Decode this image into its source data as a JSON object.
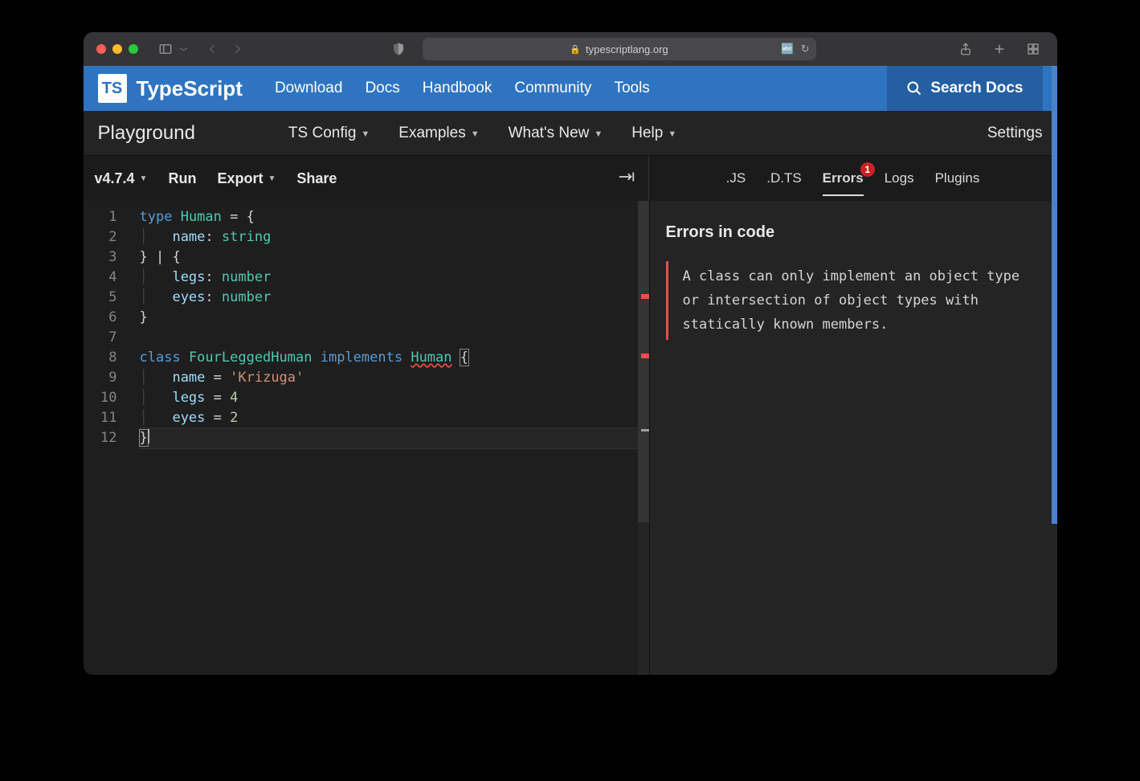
{
  "browser": {
    "url": "typescriptlang.org"
  },
  "topnav": {
    "brand": "TypeScript",
    "logo_abbr": "TS",
    "links": [
      "Download",
      "Docs",
      "Handbook",
      "Community",
      "Tools"
    ],
    "search_label": "Search Docs"
  },
  "pgbar": {
    "title": "Playground",
    "items": [
      "TS Config",
      "Examples",
      "What's New",
      "Help"
    ],
    "settings": "Settings"
  },
  "toolbar": {
    "version": "v4.7.4",
    "run": "Run",
    "export": "Export",
    "share": "Share",
    "tabs": [
      ".JS",
      ".D.TS",
      "Errors",
      "Logs",
      "Plugins"
    ],
    "active_tab": 2,
    "error_badge": "1"
  },
  "editor": {
    "lines": [
      {
        "n": 1,
        "tokens": [
          [
            "key",
            "type"
          ],
          [
            "sp",
            " "
          ],
          [
            "type",
            "Human"
          ],
          [
            "sp",
            " "
          ],
          [
            "punc",
            "= {"
          ]
        ]
      },
      {
        "n": 2,
        "tokens": [
          [
            "guide",
            "│   "
          ],
          [
            "prop",
            "name"
          ],
          [
            "punc",
            ": "
          ],
          [
            "type",
            "string"
          ]
        ]
      },
      {
        "n": 3,
        "tokens": [
          [
            "punc",
            "} | {"
          ]
        ]
      },
      {
        "n": 4,
        "tokens": [
          [
            "guide",
            "│   "
          ],
          [
            "prop",
            "legs"
          ],
          [
            "punc",
            ": "
          ],
          [
            "type",
            "number"
          ]
        ]
      },
      {
        "n": 5,
        "tokens": [
          [
            "guide",
            "│   "
          ],
          [
            "prop",
            "eyes"
          ],
          [
            "punc",
            ": "
          ],
          [
            "type",
            "number"
          ]
        ]
      },
      {
        "n": 6,
        "tokens": [
          [
            "punc",
            "}"
          ]
        ]
      },
      {
        "n": 7,
        "tokens": []
      },
      {
        "n": 8,
        "tokens": [
          [
            "key",
            "class"
          ],
          [
            "sp",
            " "
          ],
          [
            "type",
            "FourLeggedHuman"
          ],
          [
            "sp",
            " "
          ],
          [
            "key",
            "implements"
          ],
          [
            "sp",
            " "
          ],
          [
            "type squiggly",
            "Human"
          ],
          [
            "sp",
            " "
          ],
          [
            "punc brace",
            "{"
          ]
        ]
      },
      {
        "n": 9,
        "tokens": [
          [
            "guide",
            "│   "
          ],
          [
            "prop",
            "name"
          ],
          [
            "sp",
            " "
          ],
          [
            "punc",
            "= "
          ],
          [
            "str",
            "'Krizuga'"
          ]
        ]
      },
      {
        "n": 10,
        "tokens": [
          [
            "guide",
            "│   "
          ],
          [
            "prop",
            "legs"
          ],
          [
            "sp",
            " "
          ],
          [
            "punc",
            "= "
          ],
          [
            "num",
            "4"
          ]
        ]
      },
      {
        "n": 11,
        "tokens": [
          [
            "guide",
            "│   "
          ],
          [
            "prop",
            "eyes"
          ],
          [
            "sp",
            " "
          ],
          [
            "punc",
            "= "
          ],
          [
            "num",
            "2"
          ]
        ]
      },
      {
        "n": 12,
        "tokens": [
          [
            "punc brace",
            "}"
          ]
        ],
        "current": true,
        "cursor_after": true
      }
    ]
  },
  "panel": {
    "heading": "Errors in code",
    "error_msg": "A class can only implement an object type or intersection of object types with statically known members."
  }
}
